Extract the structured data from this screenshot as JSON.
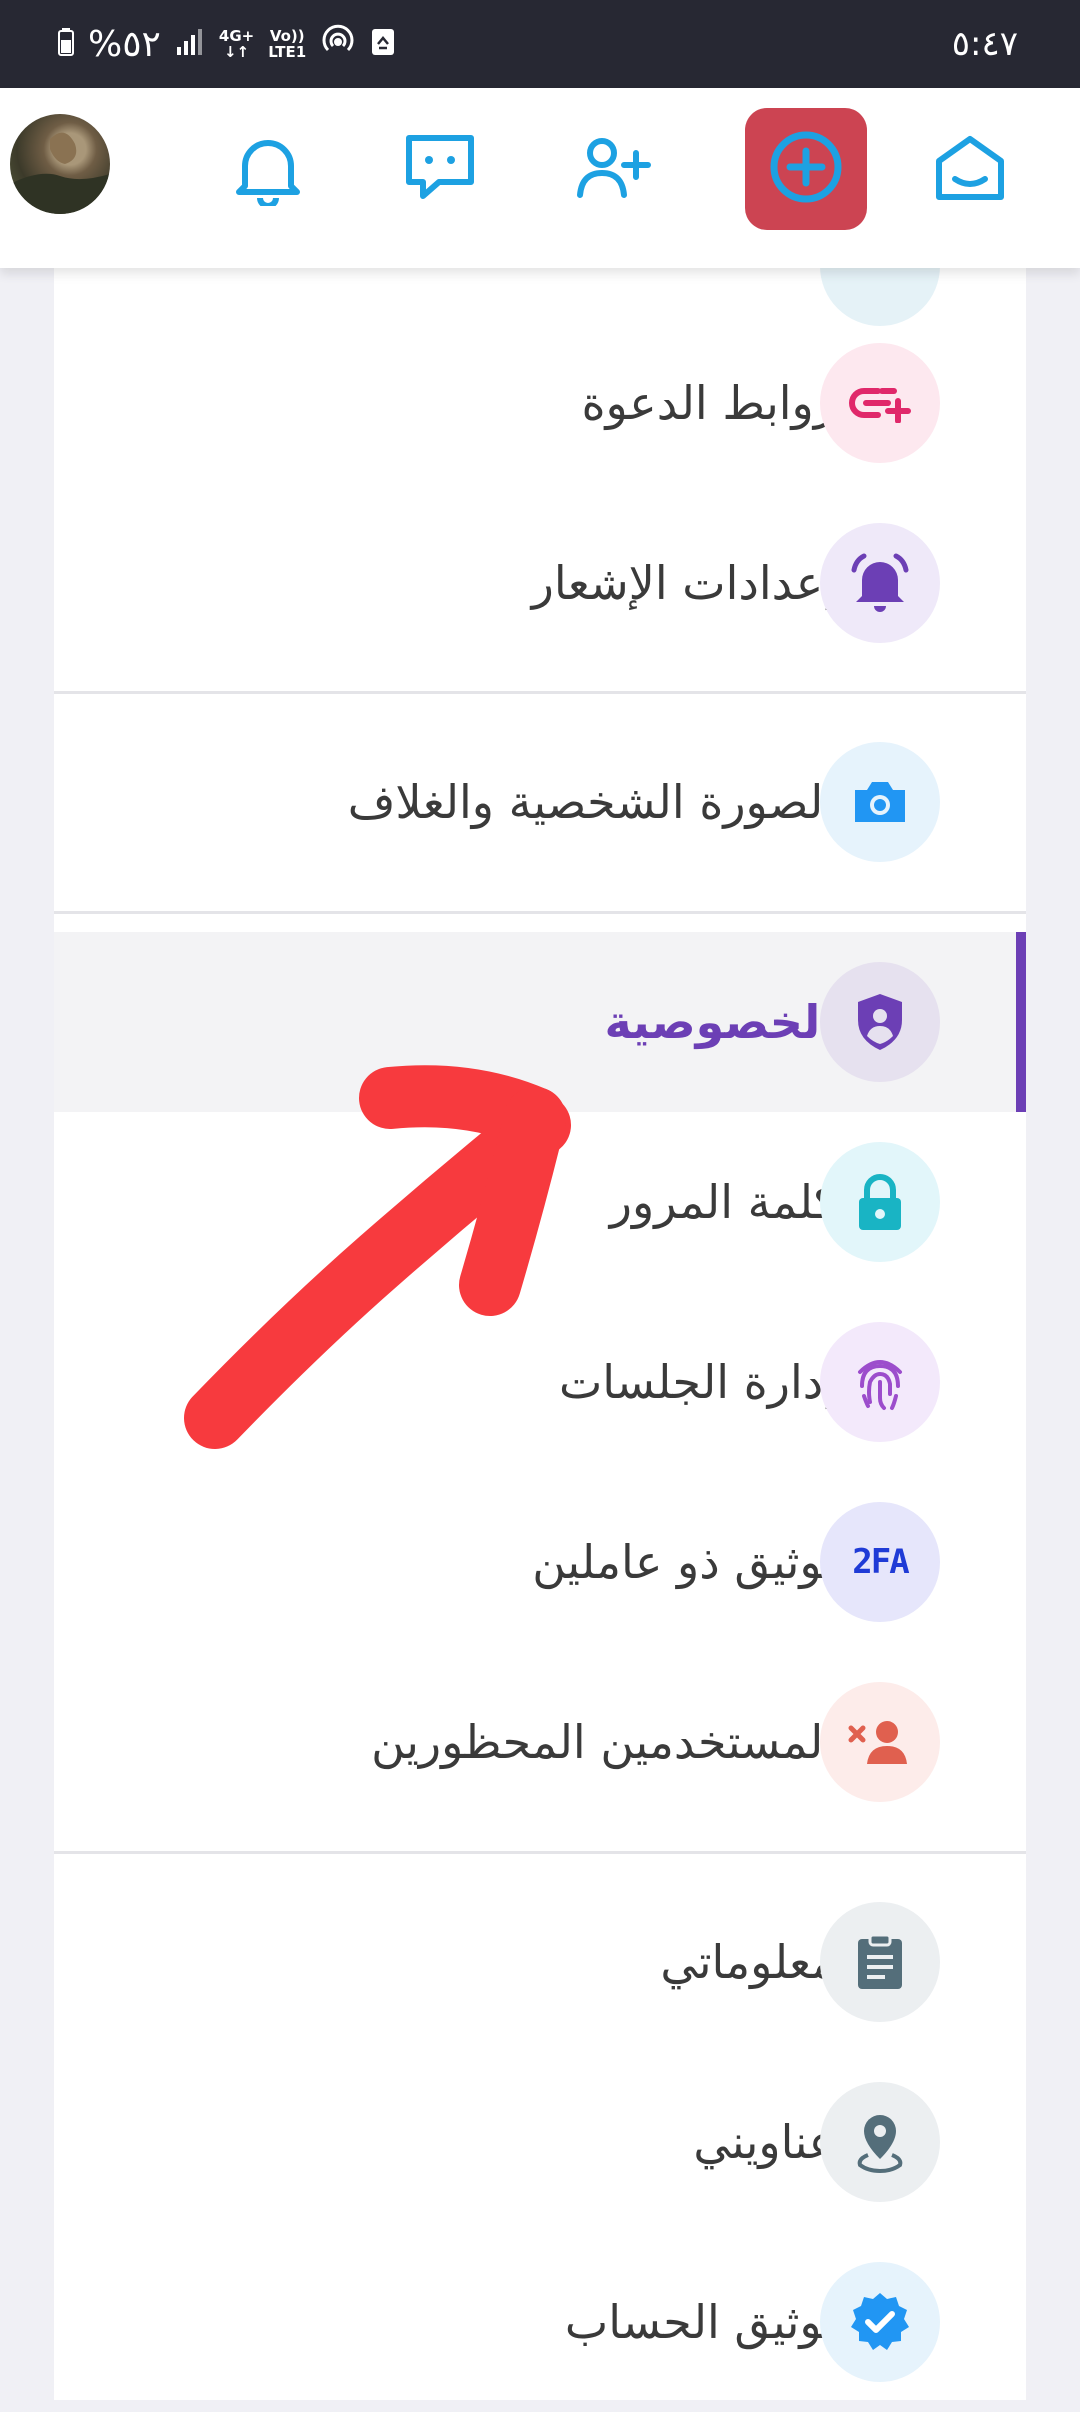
{
  "status_bar": {
    "battery": "%٥٢",
    "network_top": "4G+",
    "volte_top": "Vo))",
    "volte_bottom": "LTE1",
    "time": "٥:٤٧"
  },
  "top_bar": {
    "icons": [
      "avatar",
      "bell-icon",
      "chat-icon",
      "add-friend-icon",
      "create-post-icon",
      "home-icon"
    ],
    "create_button_color": "#cc4452",
    "icon_color": "#1da1e2"
  },
  "menu": {
    "items": [
      {
        "label": "روابط الدعوة",
        "icon": "invite-link-icon",
        "icon_bg": "#fde8ef",
        "icon_color": "#e0286a"
      },
      {
        "label": "إعدادات الإشعار",
        "icon": "bell-ring-icon",
        "icon_bg": "#efe9f9",
        "icon_color": "#6c3fb5"
      },
      {
        "label": "الصورة الشخصية والغلاف",
        "icon": "camera-icon",
        "icon_bg": "#e6f3fc",
        "icon_color": "#2196f3"
      },
      {
        "label": "الخصوصية",
        "icon": "shield-user-icon",
        "icon_bg": "#e6e1ef",
        "icon_color": "#6c3fb5",
        "active": true
      },
      {
        "label": "كلمة المرور",
        "icon": "lock-icon",
        "icon_bg": "#e2f6fa",
        "icon_color": "#19b4c4"
      },
      {
        "label": "إدارة الجلسات",
        "icon": "fingerprint-icon",
        "icon_bg": "#f3e9fb",
        "icon_color": "#9c4dcc"
      },
      {
        "label": "توثيق ذو عاملين",
        "icon": "2fa-icon",
        "icon_text": "2FA",
        "icon_bg": "#e6e6fb",
        "icon_color": "#1f3bd6"
      },
      {
        "label": "المستخدمين المحظورين",
        "icon": "blocked-user-icon",
        "icon_bg": "#fdecea",
        "icon_color": "#e0604f"
      },
      {
        "label": "معلوماتي",
        "icon": "clipboard-icon",
        "icon_bg": "#eceff1",
        "icon_color": "#546e7a"
      },
      {
        "label": "عناويني",
        "icon": "location-pin-icon",
        "icon_bg": "#eceff1",
        "icon_color": "#546e7a"
      },
      {
        "label": "توثيق الحساب",
        "icon": "verified-badge-icon",
        "icon_bg": "#e6f3fc",
        "icon_color": "#2196f3"
      }
    ]
  },
  "annotation": {
    "type": "red-arrow",
    "color": "#f73a3e",
    "points_to": "الخصوصية"
  }
}
